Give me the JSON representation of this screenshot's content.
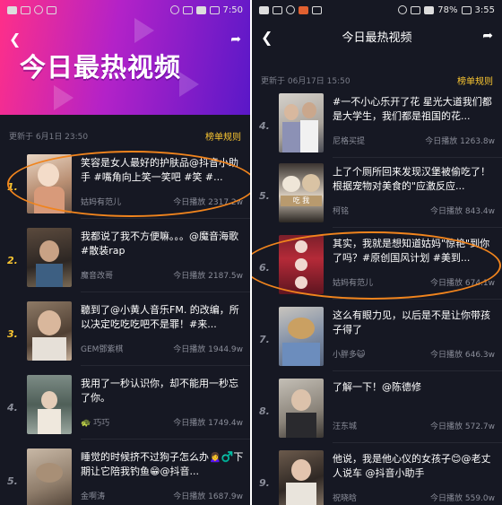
{
  "left": {
    "status": {
      "time": "7:50"
    },
    "banner_title": "今日最热视频",
    "update_text": "更新于 6月1日 23:50",
    "rules_label": "榜单规则",
    "items": [
      {
        "rank": "1.",
        "title": "笑容是女人最好的护肤品@抖音小助手 #嘴角向上笑一笑吧 #笑 #...",
        "author": "姑妈有范儿",
        "plays": "今日播放 2317.2w"
      },
      {
        "rank": "2.",
        "title": "我都说了我不方便嘛。。。@魔音海歌 #散装rap",
        "author": "魔音改哥",
        "plays": "今日播放 2187.5w"
      },
      {
        "rank": "3.",
        "title": "聽到了@小黄人音乐FM. 的改编，所以决定吃吃吃吧不是罪！#来...",
        "author": "GEM鄧紫棋",
        "plays": "今日播放 1944.9w"
      },
      {
        "rank": "4.",
        "title": "我用了一秒认识你，却不能用一秒忘了你。",
        "author": "🐢 巧巧",
        "plays": "今日播放 1749.4w"
      },
      {
        "rank": "5.",
        "title": "睡觉的时候挤不过狗子怎么办🙍‍♀️♂️下期让它陪我钓鱼😁@抖音...",
        "author": "金啊涛",
        "plays": "今日播放 1687.9w"
      }
    ]
  },
  "right": {
    "status": {
      "battery": "78%",
      "time": "3:55"
    },
    "nav_title": "今日最热视频",
    "update_text": "更新于 06月17日 15:50",
    "rules_label": "榜单规则",
    "items": [
      {
        "rank": "4.",
        "title": "#一不小心乐开了花 星光大道我们都是大学生，我们都是祖国的花...",
        "author": "尼格买提",
        "plays": "今日播放 1263.8w"
      },
      {
        "rank": "5.",
        "title": "上了个厕所回来发现汉堡被偷吃了！根据宠物对美食的\"应激反应...",
        "author": "柯铭",
        "plays": "今日播放 843.4w",
        "thumb_text": "吃 我"
      },
      {
        "rank": "6.",
        "title": "其实，我就是想知道姑妈\"惊艳\"到你了吗？#原创国风计划 #美到...",
        "author": "姑妈有范儿",
        "plays": "今日播放 674.1w"
      },
      {
        "rank": "7.",
        "title": "这么有眼力见，以后是不是让你带孩子得了",
        "author": "小胖多😺",
        "plays": "今日播放 646.3w"
      },
      {
        "rank": "8.",
        "title": "了解一下！@陈德修",
        "author": "汪东城",
        "plays": "今日播放 572.7w"
      },
      {
        "rank": "9.",
        "title": "他说，我是他心仪的女孩子😊@老丈人说车 @抖音小助手",
        "author": "祝晓晗",
        "plays": "今日播放 559.0w"
      }
    ]
  },
  "colors": {
    "accent_gold": "#f9c531",
    "highlight_oval": "#f0841d",
    "background": "#161823"
  },
  "icons": {
    "back": "chevron-left-icon",
    "share": "share-arrow-icon"
  }
}
